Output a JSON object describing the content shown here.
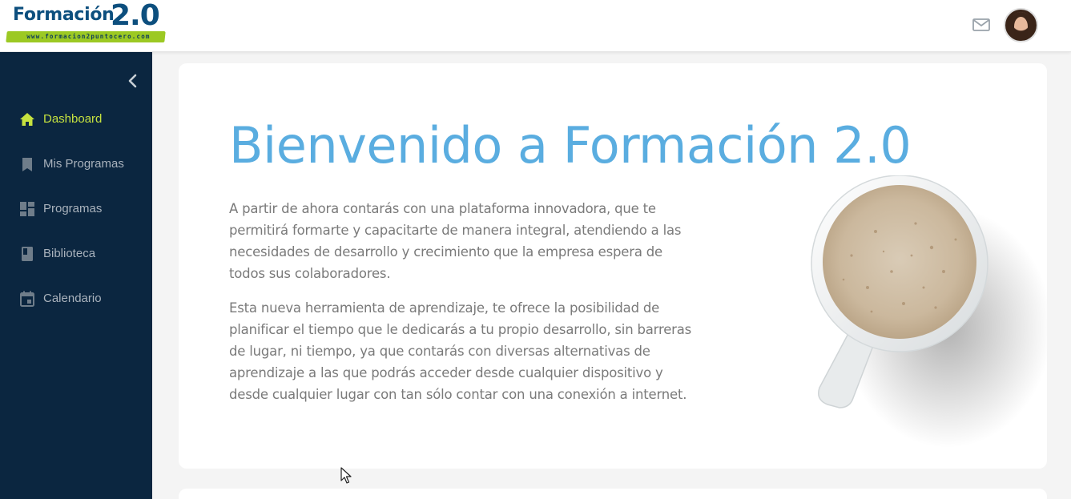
{
  "brand": {
    "name": "Formación",
    "version": "2.0",
    "url": "www.formacion2puntocero.com",
    "colors": {
      "primary": "#0d4f7e",
      "accent": "#9cc923"
    }
  },
  "header": {
    "mail_icon": "mail-icon",
    "avatar": "user-avatar"
  },
  "sidebar": {
    "collapse_icon": "chevron-left-icon",
    "items": [
      {
        "label": "Dashboard",
        "icon": "home-icon",
        "active": true
      },
      {
        "label": "Mis Programas",
        "icon": "bookmark-icon",
        "active": false
      },
      {
        "label": "Programas",
        "icon": "dashboard-grid-icon",
        "active": false
      },
      {
        "label": "Biblioteca",
        "icon": "book-icon",
        "active": false
      },
      {
        "label": "Calendario",
        "icon": "calendar-icon",
        "active": false
      }
    ],
    "colors": {
      "background": "#0b2640",
      "active": "#c6e23f",
      "text": "#a9b2bc"
    }
  },
  "main": {
    "title": "Bienvenido a Formación 2.0",
    "paragraphs": [
      "A partir de ahora contarás con una plataforma innovadora, que te permitirá formarte y capacitarte de manera integral, atendiendo a las necesidades de desarrollo y crecimiento que la empresa espera de todos sus colaboradores.",
      "Esta nueva herramienta de aprendizaje, te ofrece la posibilidad de planificar el tiempo que le dedicarás a tu propio desarrollo, sin barreras de lugar, ni tiempo, ya que contarás con diversas alternativas de aprendizaje a las que podrás acceder desde cualquier dispositivo y desde cualquier lugar con tan sólo contar con una conexión a internet."
    ],
    "image": "coffee-cup-image",
    "colors": {
      "title": "#5aade0",
      "text": "#7a7a7a"
    }
  }
}
